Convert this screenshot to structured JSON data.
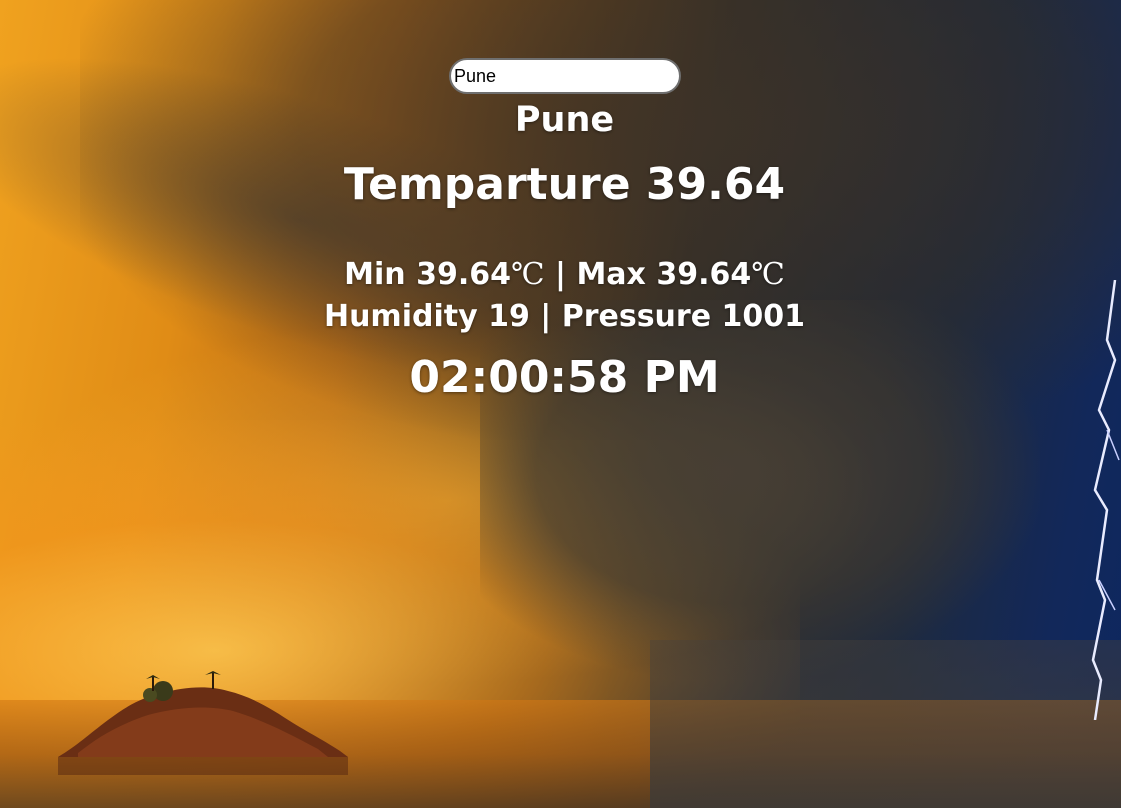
{
  "search": {
    "value": "Pune"
  },
  "weather": {
    "city": "Pune",
    "temperature_label": "Temparture",
    "temperature": "39.64",
    "min_label": "Min",
    "min": "39.64",
    "max_label": "Max",
    "max": "39.64",
    "unit": "℃",
    "separator": "|",
    "humidity_label": "Humidity",
    "humidity": "19",
    "pressure_label": "Pressure",
    "pressure": "1001",
    "time": "02:00:58 PM"
  },
  "background": {
    "scene": "stormy sky over sea with island and lightning",
    "icons": [
      "island-image",
      "lightning-image"
    ]
  }
}
